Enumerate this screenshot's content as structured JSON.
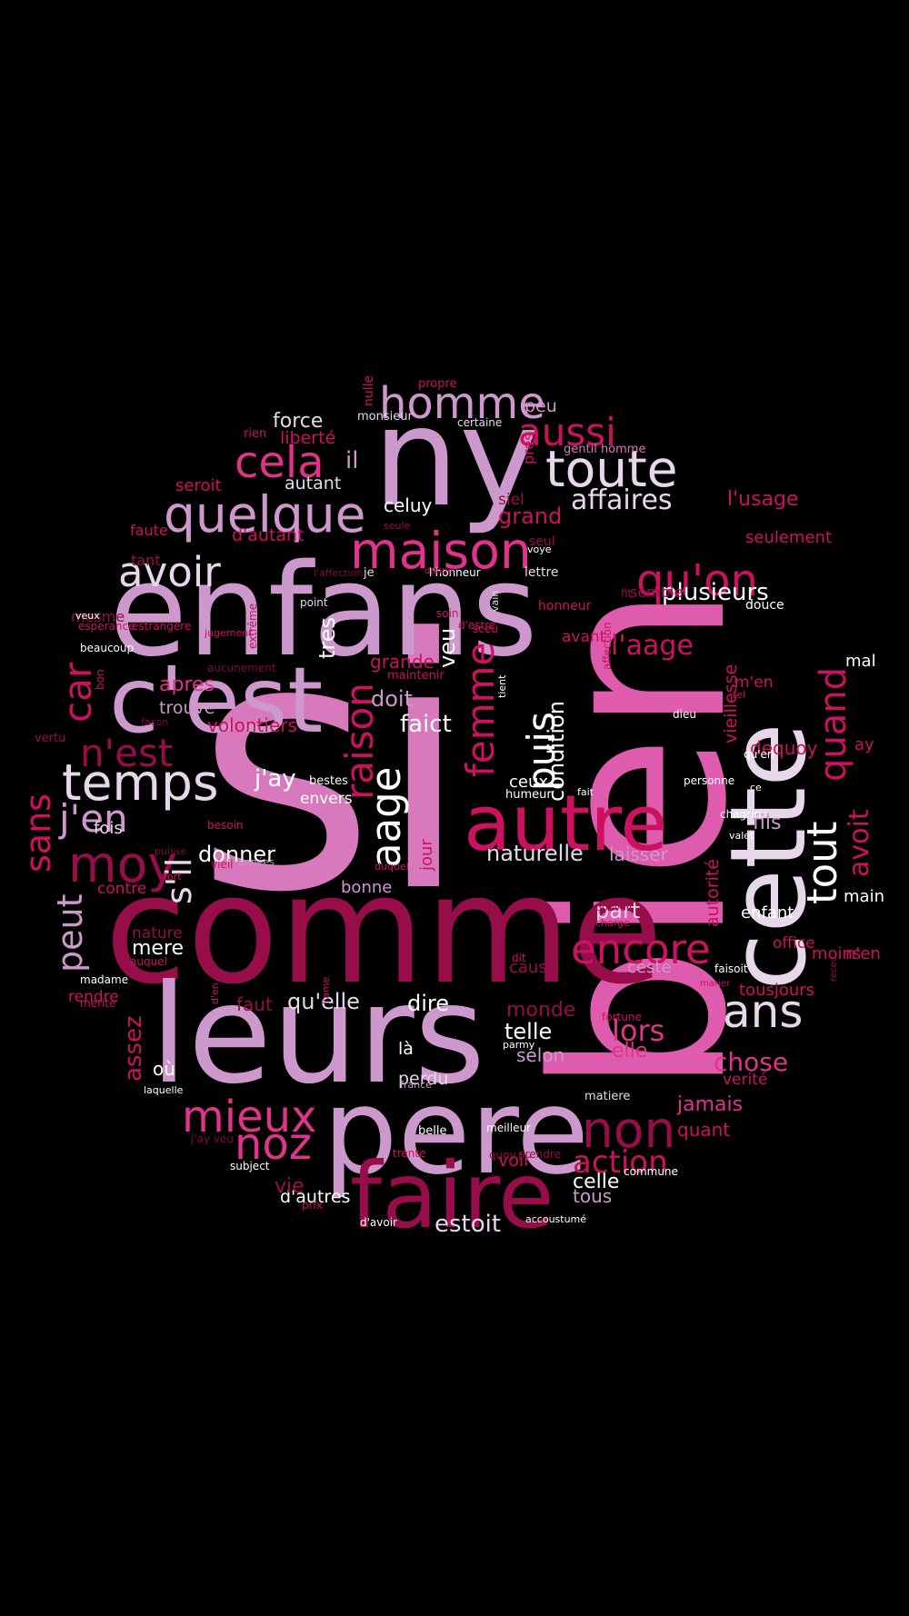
{
  "colors": {
    "background": "#000000",
    "white": "#ffffff",
    "light": "#e6d8ea",
    "lavender": "#cd98cc",
    "orchid": "#d779bc",
    "pink": "#df5bad",
    "hotpink": "#e0338a",
    "crimson": "#cb1160",
    "maroon": "#960d4a",
    "dark": "#7d0a3c"
  },
  "words": [
    {
      "text": "si",
      "color": "orchid"
    },
    {
      "text": "bien",
      "color": "pink"
    },
    {
      "text": "comme",
      "color": "maroon"
    },
    {
      "text": "enfans",
      "color": "lavender"
    },
    {
      "text": "cette",
      "color": "light"
    },
    {
      "text": "leurs",
      "color": "lavender"
    },
    {
      "text": "ny",
      "color": "lavender"
    },
    {
      "text": "pere",
      "color": "lavender"
    },
    {
      "text": "c'est",
      "color": "lavender"
    },
    {
      "text": "faire",
      "color": "maroon"
    },
    {
      "text": "autre",
      "color": "crimson"
    },
    {
      "text": "quelque",
      "color": "lavender"
    },
    {
      "text": "maison",
      "color": "hotpink"
    },
    {
      "text": "toute",
      "color": "light"
    },
    {
      "text": "temps",
      "color": "light"
    },
    {
      "text": "homme",
      "color": "lavender"
    },
    {
      "text": "cela",
      "color": "hotpink"
    },
    {
      "text": "qu'on",
      "color": "crimson"
    },
    {
      "text": "avoir",
      "color": "light"
    },
    {
      "text": "aussi",
      "color": "crimson"
    },
    {
      "text": "moy",
      "color": "maroon"
    },
    {
      "text": "non",
      "color": "maroon"
    },
    {
      "text": "mieux",
      "color": "hotpink"
    },
    {
      "text": "noz",
      "color": "hotpink"
    },
    {
      "text": "encore",
      "color": "crimson"
    },
    {
      "text": "ans",
      "color": "light"
    },
    {
      "text": "affaires",
      "color": "light"
    },
    {
      "text": "j'en",
      "color": "lavender"
    },
    {
      "text": "n'est",
      "color": "maroon"
    },
    {
      "text": "car",
      "color": "crimson"
    },
    {
      "text": "aage",
      "color": "white"
    },
    {
      "text": "raison",
      "color": "crimson"
    },
    {
      "text": "femme",
      "color": "crimson"
    },
    {
      "text": "puis",
      "color": "white"
    },
    {
      "text": "tout",
      "color": "white"
    },
    {
      "text": "quand",
      "color": "crimson"
    },
    {
      "text": "sans",
      "color": "crimson"
    },
    {
      "text": "peut",
      "color": "lavender"
    },
    {
      "text": "s'il",
      "color": "light"
    },
    {
      "text": "action",
      "color": "crimson"
    },
    {
      "text": "plusieurs",
      "color": "white"
    },
    {
      "text": "l'aage",
      "color": "crimson"
    },
    {
      "text": "chose",
      "color": "hotpink"
    },
    {
      "text": "lors",
      "color": "hotpink"
    },
    {
      "text": "j'ay",
      "color": "white"
    },
    {
      "text": "faict",
      "color": "white"
    },
    {
      "text": "naturelle",
      "color": "light"
    },
    {
      "text": "qu'elle",
      "color": "light"
    },
    {
      "text": "grand",
      "color": "crimson"
    },
    {
      "text": "assez",
      "color": "crimson"
    },
    {
      "text": "avoit",
      "color": "crimson"
    },
    {
      "text": "condition",
      "color": "white"
    },
    {
      "text": "donner",
      "color": "white"
    },
    {
      "text": "telle",
      "color": "white"
    },
    {
      "text": "dire",
      "color": "white"
    },
    {
      "text": "doit",
      "color": "lavender"
    },
    {
      "text": "apres",
      "color": "hotpink"
    },
    {
      "text": "part",
      "color": "light"
    },
    {
      "text": "mere",
      "color": "white"
    },
    {
      "text": "estoit",
      "color": "light"
    },
    {
      "text": "celle",
      "color": "white"
    },
    {
      "text": "force",
      "color": "light"
    },
    {
      "text": "celuy",
      "color": "white"
    },
    {
      "text": "il",
      "color": "lavender"
    },
    {
      "text": "tres",
      "color": "white"
    },
    {
      "text": "veu",
      "color": "white"
    },
    {
      "text": "volontiers",
      "color": "crimson"
    },
    {
      "text": "jamais",
      "color": "hotpink"
    },
    {
      "text": "fils",
      "color": "lavender"
    },
    {
      "text": "laisser",
      "color": "lavender"
    },
    {
      "text": "trouve",
      "color": "lavender"
    },
    {
      "text": "elle",
      "color": "hotpink"
    },
    {
      "text": "selon",
      "color": "lavender"
    },
    {
      "text": "d'autres",
      "color": "white"
    },
    {
      "text": "tous",
      "color": "lavender"
    },
    {
      "text": "quant",
      "color": "crimson"
    },
    {
      "text": "dequoy",
      "color": "crimson"
    },
    {
      "text": "vieillesse",
      "color": "crimson"
    },
    {
      "text": "autorité",
      "color": "crimson"
    },
    {
      "text": "tousjours",
      "color": "crimson"
    },
    {
      "text": "seulement",
      "color": "crimson"
    },
    {
      "text": "l'usage",
      "color": "crimson"
    },
    {
      "text": "peu",
      "color": "lavender"
    },
    {
      "text": "liberté",
      "color": "crimson"
    },
    {
      "text": "autant",
      "color": "light"
    },
    {
      "text": "d'autant",
      "color": "crimson"
    },
    {
      "text": "seroit",
      "color": "crimson"
    },
    {
      "text": "grande",
      "color": "crimson"
    },
    {
      "text": "monde",
      "color": "maroon"
    },
    {
      "text": "vie",
      "color": "maroon"
    },
    {
      "text": "faut",
      "color": "maroon"
    },
    {
      "text": "où",
      "color": "white"
    },
    {
      "text": "là",
      "color": "white"
    },
    {
      "text": "perdu",
      "color": "light"
    },
    {
      "text": "voir",
      "color": "crimson"
    },
    {
      "text": "jour",
      "color": "crimson"
    },
    {
      "text": "bonne",
      "color": "lavender"
    },
    {
      "text": "fois",
      "color": "light"
    },
    {
      "text": "envers",
      "color": "white"
    },
    {
      "text": "contre",
      "color": "crimson"
    },
    {
      "text": "nature",
      "color": "maroon"
    },
    {
      "text": "rendre",
      "color": "crimson"
    },
    {
      "text": "avant",
      "color": "crimson"
    },
    {
      "text": "ceux",
      "color": "white"
    },
    {
      "text": "cause",
      "color": "maroon"
    },
    {
      "text": "ceste",
      "color": "lavender"
    },
    {
      "text": "enfant",
      "color": "white"
    },
    {
      "text": "moins",
      "color": "crimson"
    },
    {
      "text": "n'en",
      "color": "crimson"
    },
    {
      "text": "main",
      "color": "white"
    },
    {
      "text": "ay",
      "color": "crimson"
    },
    {
      "text": "mal",
      "color": "white"
    },
    {
      "text": "m'en",
      "color": "crimson"
    },
    {
      "text": "verité",
      "color": "crimson"
    },
    {
      "text": "office",
      "color": "crimson"
    },
    {
      "text": "siel",
      "color": "maroon"
    },
    {
      "text": "semble",
      "color": "maroon"
    },
    {
      "text": "faute",
      "color": "crimson"
    },
    {
      "text": "tant",
      "color": "maroon"
    },
    {
      "text": "mesme",
      "color": "maroon"
    },
    {
      "text": "pres",
      "color": "crimson"
    },
    {
      "text": "seul",
      "color": "maroon"
    },
    {
      "text": "lettre",
      "color": "light"
    },
    {
      "text": "honneur",
      "color": "crimson"
    },
    {
      "text": "douce",
      "color": "white"
    },
    {
      "text": "gentil homme",
      "color": "orchid"
    },
    {
      "text": "certaine",
      "color": "light"
    },
    {
      "text": "monsieur",
      "color": "light"
    },
    {
      "text": "rien",
      "color": "crimson"
    },
    {
      "text": "propre",
      "color": "crimson"
    },
    {
      "text": "nulle",
      "color": "crimson"
    },
    {
      "text": "je",
      "color": "light"
    },
    {
      "text": "l'honneur",
      "color": "white"
    },
    {
      "text": "l'affection",
      "color": "dark"
    },
    {
      "text": "vain",
      "color": "light"
    },
    {
      "text": "point",
      "color": "light"
    },
    {
      "text": "extrême",
      "color": "crimson"
    },
    {
      "text": "estrangere",
      "color": "crimson"
    },
    {
      "text": "jugement",
      "color": "crimson"
    },
    {
      "text": "soin",
      "color": "crimson"
    },
    {
      "text": "sceu",
      "color": "crimson"
    },
    {
      "text": "d'estre",
      "color": "crimson"
    },
    {
      "text": "affection",
      "color": "crimson"
    },
    {
      "text": "aucunement",
      "color": "dark"
    },
    {
      "text": "maintenir",
      "color": "crimson"
    },
    {
      "text": "bon",
      "color": "crimson"
    },
    {
      "text": "beaucoup",
      "color": "white"
    },
    {
      "text": "esperance",
      "color": "crimson"
    },
    {
      "text": "veux",
      "color": "white"
    },
    {
      "text": "vertu",
      "color": "maroon"
    },
    {
      "text": "façon",
      "color": "dark"
    },
    {
      "text": "bestes",
      "color": "white"
    },
    {
      "text": "tient",
      "color": "white"
    },
    {
      "text": "dieu",
      "color": "white"
    },
    {
      "text": "qu'en",
      "color": "white"
    },
    {
      "text": "ce",
      "color": "white"
    },
    {
      "text": "personne",
      "color": "white"
    },
    {
      "text": "chagrin",
      "color": "white"
    },
    {
      "text": "valet",
      "color": "white"
    },
    {
      "text": "humeur",
      "color": "white"
    },
    {
      "text": "fait",
      "color": "white"
    },
    {
      "text": "besoin",
      "color": "crimson"
    },
    {
      "text": "puisse",
      "color": "dark"
    },
    {
      "text": "vieil",
      "color": "crimson"
    },
    {
      "text": "années",
      "color": "lavender"
    },
    {
      "text": "duquel",
      "color": "crimson"
    },
    {
      "text": "fort",
      "color": "crimson"
    },
    {
      "text": "auquel",
      "color": "crimson"
    },
    {
      "text": "madame",
      "color": "white"
    },
    {
      "text": "merite",
      "color": "crimson"
    },
    {
      "text": "d'en",
      "color": "crimson"
    },
    {
      "text": "l'ame",
      "color": "crimson"
    },
    {
      "text": "laquelle",
      "color": "white"
    },
    {
      "text": "j'ay veu",
      "color": "dark"
    },
    {
      "text": "subject",
      "color": "white"
    },
    {
      "text": "france",
      "color": "lavender"
    },
    {
      "text": "parmy",
      "color": "white"
    },
    {
      "text": "matiere",
      "color": "light"
    },
    {
      "text": "belle",
      "color": "white"
    },
    {
      "text": "meilleur",
      "color": "white"
    },
    {
      "text": "trente",
      "color": "crimson"
    },
    {
      "text": "quoy",
      "color": "maroon"
    },
    {
      "text": "prendre",
      "color": "maroon"
    },
    {
      "text": "commune",
      "color": "white"
    },
    {
      "text": "d'avoir",
      "color": "white"
    },
    {
      "text": "accoustumé",
      "color": "white"
    },
    {
      "text": "prix",
      "color": "crimson"
    },
    {
      "text": "dit",
      "color": "crimson"
    },
    {
      "text": "fortune",
      "color": "crimson"
    },
    {
      "text": "faisoit",
      "color": "white"
    },
    {
      "text": "marier",
      "color": "crimson"
    },
    {
      "text": "receu",
      "color": "maroon"
    },
    {
      "text": "tel",
      "color": "crimson"
    },
    {
      "text": "charge",
      "color": "crimson"
    },
    {
      "text": "pouvoit",
      "color": "maroon"
    },
    {
      "text": "fit",
      "color": "maroon"
    },
    {
      "text": "voye",
      "color": "white"
    },
    {
      "text": "donne",
      "color": "crimson"
    },
    {
      "text": "seule",
      "color": "maroon"
    },
    {
      "text": "vingt",
      "color": "maroon"
    }
  ]
}
